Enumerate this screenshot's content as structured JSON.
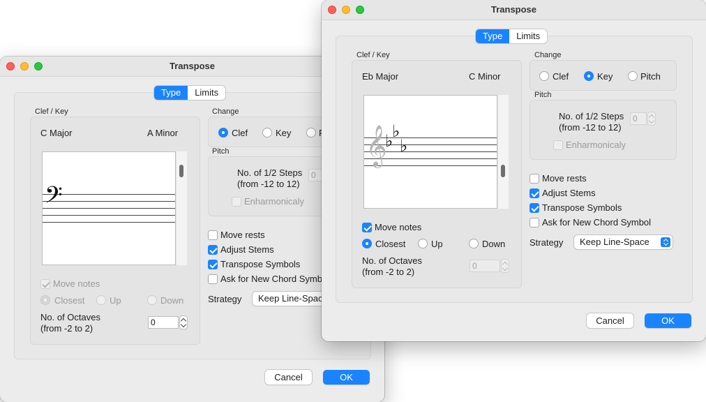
{
  "colors": {
    "accent": "#1a84fe",
    "window_bg": "#ececec"
  },
  "back": {
    "title": "Transpose",
    "tabs": [
      "Type",
      "Limits"
    ],
    "clef_key_label": "Clef / Key",
    "key_left": "C Major",
    "key_right": "A Minor",
    "staff_symbol": "𝄢",
    "move_notes": "Move notes",
    "closest": "Closest",
    "up": "Up",
    "down": "Down",
    "octaves_line1": "No. of Octaves",
    "octaves_line2": "(from -2 to 2)",
    "octaves_value": "0",
    "change_label": "Change",
    "change_options": [
      "Clef",
      "Key",
      "P"
    ],
    "pitch_label": "Pitch",
    "steps_line1": "No. of 1/2 Steps",
    "steps_line2": "(from -12 to 12)",
    "steps_value": "0",
    "enharmonicaly": "Enharmonicaly",
    "move_rests": "Move rests",
    "adjust_stems": "Adjust Stems",
    "transpose_symbols": "Transpose Symbols",
    "ask_chord": "Ask for New Chord Symbol",
    "strategy_label": "Strategy",
    "strategy_value": "Keep Line-Spac",
    "cancel": "Cancel",
    "ok": "OK"
  },
  "front": {
    "title": "Transpose",
    "tabs": [
      "Type",
      "Limits"
    ],
    "clef_key_label": "Clef / Key",
    "key_left": "Eb Major",
    "key_right": "C Minor",
    "clef_symbol": "𝄞",
    "flats": [
      "♭",
      "♭",
      "♭"
    ],
    "move_notes": "Move notes",
    "closest": "Closest",
    "up": "Up",
    "down": "Down",
    "octaves_line1": "No. of Octaves",
    "octaves_line2": "(from -2 to 2)",
    "octaves_value": "0",
    "change_label": "Change",
    "change_options": [
      "Clef",
      "Key",
      "Pitch"
    ],
    "pitch_label": "Pitch",
    "steps_line1": "No. of 1/2 Steps",
    "steps_line2": "(from -12 to 12)",
    "steps_value": "0",
    "enharmonicaly": "Enharmonicaly",
    "move_rests": "Move rests",
    "adjust_stems": "Adjust Stems",
    "transpose_symbols": "Transpose Symbols",
    "ask_chord": "Ask for New Chord Symbol",
    "strategy_label": "Strategy",
    "strategy_value": "Keep Line-Space",
    "cancel": "Cancel",
    "ok": "OK"
  }
}
